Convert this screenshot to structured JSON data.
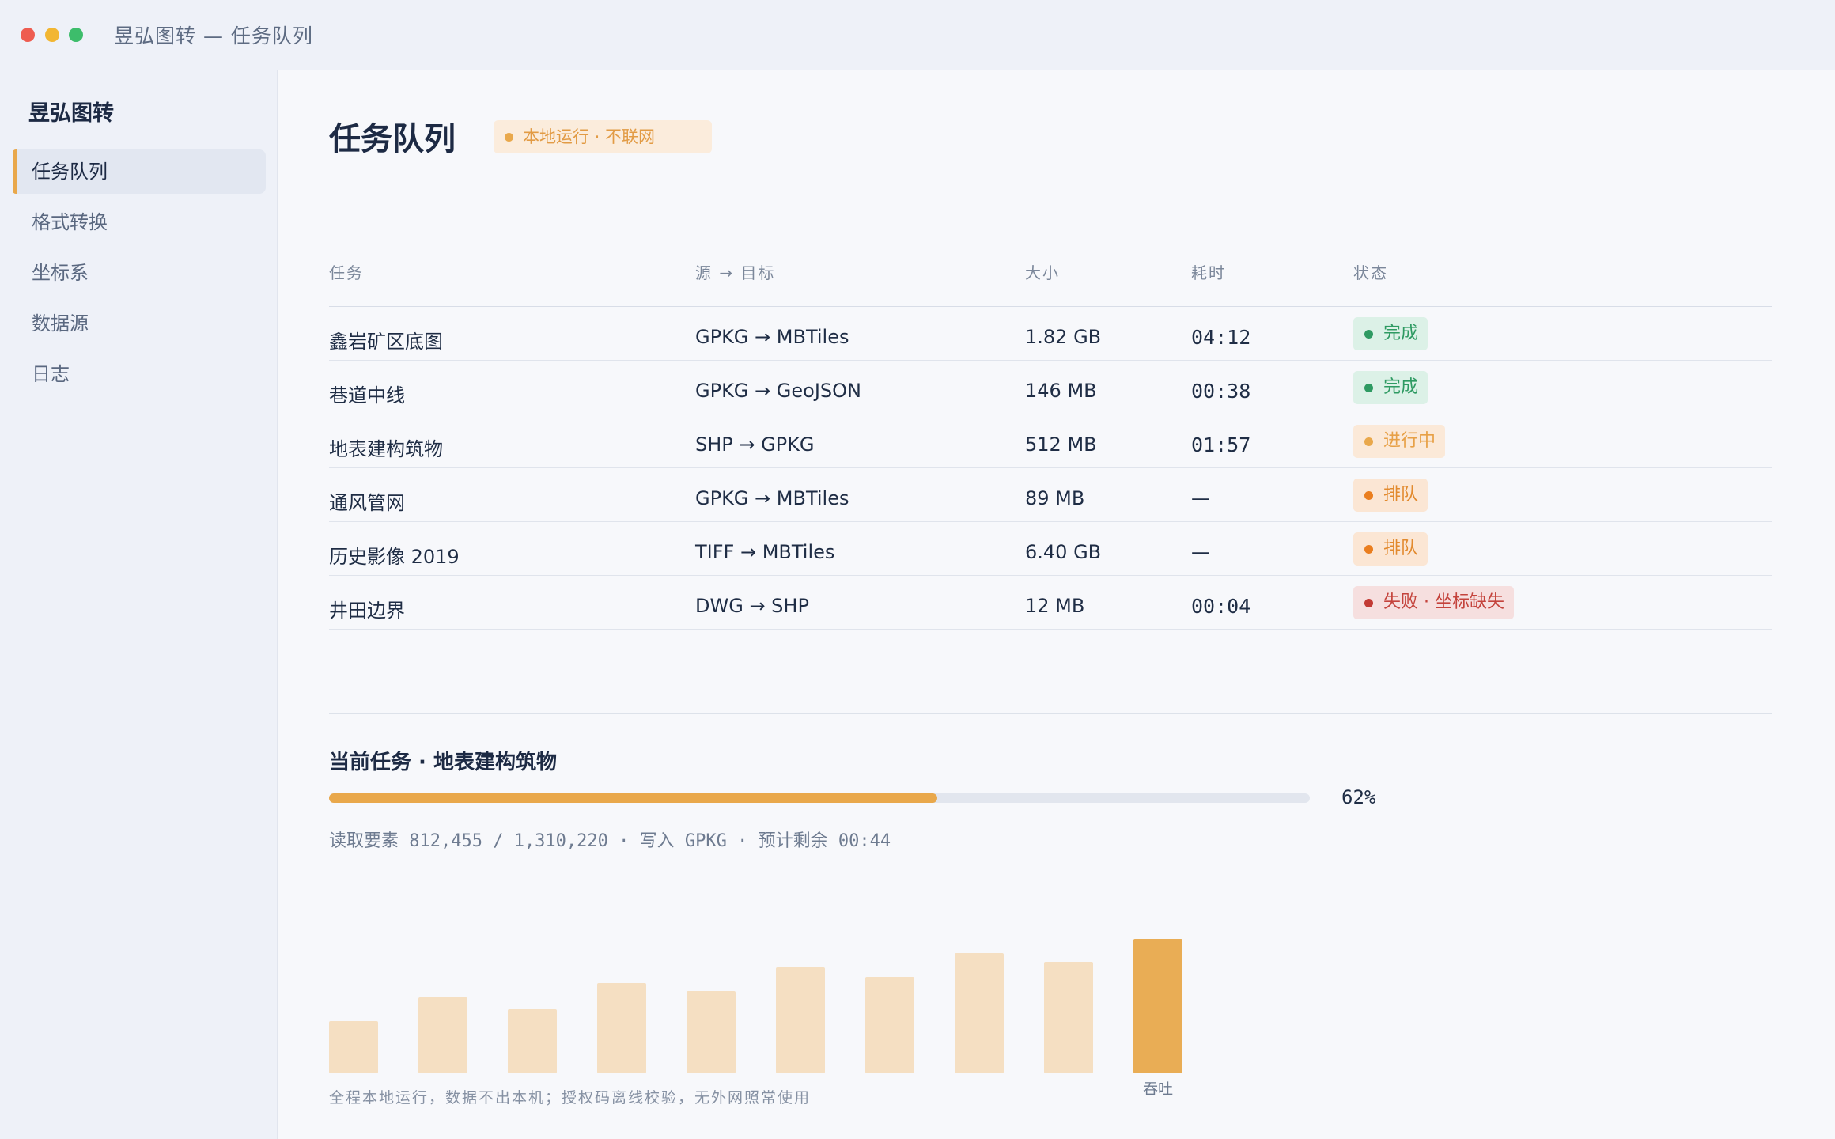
{
  "window": {
    "title": "昱弘图转 — 任务队列",
    "controls": [
      "close",
      "minimize",
      "maximize"
    ]
  },
  "sidebar": {
    "brand": "昱弘图转",
    "items": [
      {
        "label": "任务队列",
        "active": true
      },
      {
        "label": "格式转换",
        "active": false
      },
      {
        "label": "坐标系",
        "active": false
      },
      {
        "label": "数据源",
        "active": false
      },
      {
        "label": "日志",
        "active": false
      }
    ]
  },
  "header": {
    "title": "任务队列",
    "badge": "本地运行 · 不联网"
  },
  "table": {
    "columns": [
      "任务",
      "源 → 目标",
      "大小",
      "耗时",
      "状态"
    ],
    "rows": [
      {
        "name": "鑫岩矿区底图",
        "route": "GPKG → MBTiles",
        "size": "1.82 GB",
        "time": "04:12",
        "status": "完成",
        "status_type": "done"
      },
      {
        "name": "巷道中线",
        "route": "GPKG → GeoJSON",
        "size": "146 MB",
        "time": "00:38",
        "status": "完成",
        "status_type": "done"
      },
      {
        "name": "地表建构筑物",
        "route": "SHP → GPKG",
        "size": "512 MB",
        "time": "01:57",
        "status": "进行中",
        "status_type": "running"
      },
      {
        "name": "通风管网",
        "route": "GPKG → MBTiles",
        "size": "89 MB",
        "time": "—",
        "status": "排队",
        "status_type": "queued"
      },
      {
        "name": "历史影像 2019",
        "route": "TIFF → MBTiles",
        "size": "6.40 GB",
        "time": "—",
        "status": "排队",
        "status_type": "queued"
      },
      {
        "name": "井田边界",
        "route": "DWG → SHP",
        "size": "12 MB",
        "time": "00:04",
        "status": "失败 · 坐标缺失",
        "status_type": "failed"
      }
    ]
  },
  "current": {
    "title": "当前任务 · 地表建构筑物",
    "progress": 0.62,
    "progress_label": "62%",
    "meta": "读取要素 812,455 / 1,310,220 · 写入 GPKG · 预计剩余 00:44"
  },
  "throughput": {
    "label": "吞吐",
    "values": [
      44,
      64,
      54,
      76,
      69,
      89,
      81,
      101,
      94,
      113
    ],
    "highlight_index": 9,
    "colors": {
      "bar": "#f5dfc2",
      "highlight": "#e9ad55"
    }
  },
  "footer": "全程本地运行，数据不出本机；授权码离线校验，无外网照常使用",
  "colors": {
    "accent": "#e9a84b",
    "done": "#2e9a62",
    "running": "#e7a046",
    "queued": "#e28a2e",
    "failed": "#c4433c"
  }
}
